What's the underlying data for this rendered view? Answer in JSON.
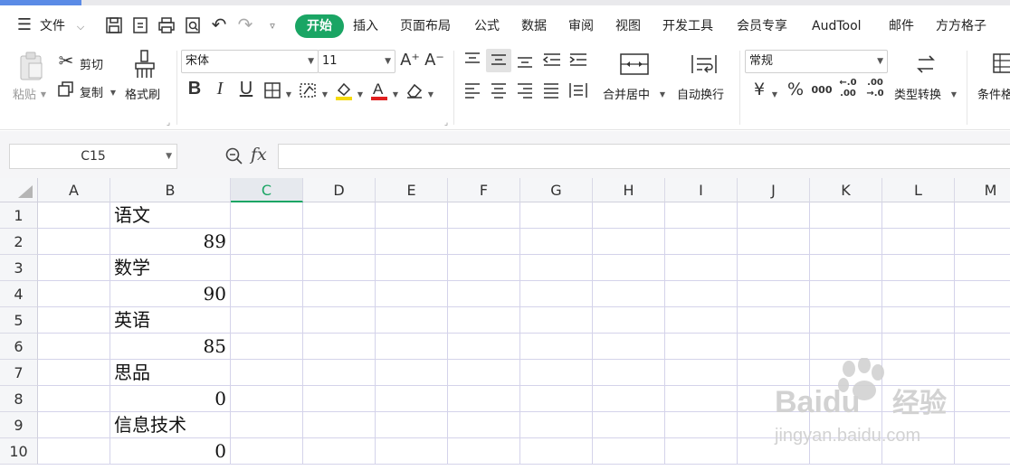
{
  "menu": {
    "file_label": "文件",
    "tabs": [
      "开始",
      "插入",
      "页面布局",
      "公式",
      "数据",
      "审阅",
      "视图",
      "开发工具",
      "会员专享",
      "AudTool",
      "邮件",
      "方方格子"
    ]
  },
  "ribbon": {
    "paste_label": "粘贴",
    "cut_label": "剪切",
    "copy_label": "复制",
    "format_painter_label": "格式刷",
    "font_name": "宋体",
    "font_size": "11",
    "merge_label": "合并居中",
    "wrap_label": "自动换行",
    "number_format": "常规",
    "convert_label": "类型转换",
    "conditional_label": "条件格式",
    "percent_symbol": "%",
    "currency_symbol": "¥",
    "thousands_symbol": "000",
    "increase_decimal": "←.0 .00",
    "decrease_decimal": ".00 →.0"
  },
  "formula_bar": {
    "name_box": "C15",
    "fx_label": "fx",
    "formula": ""
  },
  "sheet": {
    "columns": [
      "A",
      "B",
      "C",
      "D",
      "E",
      "F",
      "G",
      "H",
      "I",
      "J",
      "K",
      "L",
      "M"
    ],
    "selected_column": "C",
    "rows": [
      "1",
      "2",
      "3",
      "4",
      "5",
      "6",
      "7",
      "8",
      "9",
      "10"
    ],
    "b_values": [
      {
        "text": "语文",
        "align": "left"
      },
      {
        "text": "89",
        "align": "right"
      },
      {
        "text": "数学",
        "align": "left"
      },
      {
        "text": "90",
        "align": "right"
      },
      {
        "text": "英语",
        "align": "left"
      },
      {
        "text": "85",
        "align": "right"
      },
      {
        "text": "思品",
        "align": "left"
      },
      {
        "text": "0",
        "align": "right"
      },
      {
        "text": "信息技术",
        "align": "left"
      },
      {
        "text": "0",
        "align": "right"
      }
    ]
  },
  "watermark": {
    "brand": "Baidu",
    "brand_cn": "经验",
    "url": "jingyan.baidu.com"
  },
  "colors": {
    "accent": "#1aa564",
    "gridline": "#d4d3ea"
  }
}
